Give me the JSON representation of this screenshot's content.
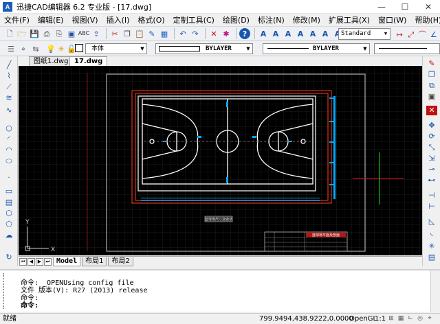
{
  "window": {
    "app_icon_text": "A",
    "title": "迅捷CAD编辑器 6.2 专业版  - [17.dwg]",
    "min": "—",
    "max": "☐",
    "close": "✕"
  },
  "menu": [
    "文件(F)",
    "编辑(E)",
    "视图(V)",
    "插入(I)",
    "格式(O)",
    "定制工具(C)",
    "绘图(D)",
    "标注(N)",
    "修改(M)",
    "扩展工具(X)",
    "窗口(W)",
    "帮助(H)"
  ],
  "toolbar1": {
    "style_value": "Standard"
  },
  "toolbar2": {
    "layer_value": "本体",
    "color_value": "BYLAYER",
    "linetype_value": "BYLAYER"
  },
  "doc_tabs": [
    "图纸1.dwg",
    "17.dwg"
  ],
  "active_doc_tab": "17.dwg",
  "drawing": {
    "title_block_caption": "篮球场尺寸及做法",
    "title_block_red": "篮球场平面及剖面",
    "ucs_y": "Y",
    "ucs_x": "X",
    "colors": {
      "background": "#000000",
      "court_line": "#ffffff",
      "frame": "#ff3b1f",
      "dimension": "#00aaff",
      "grid": "#1c1c1c",
      "crosshair_red": "#d01010",
      "crosshair_green": "#10c010"
    }
  },
  "layout_tabs": [
    "Model",
    "布局1",
    "布局2"
  ],
  "active_layout_tab": "Model",
  "command_history": [
    "命令: _OPENUsing config file",
    "文件 版本(V): R27 (2013) release",
    "命令:",
    "命令:"
  ],
  "status": {
    "left": "就绪",
    "coordinates": "799.9494,438.9222,0.0000",
    "renderer": "OpenGL",
    "scale": "1:1"
  }
}
